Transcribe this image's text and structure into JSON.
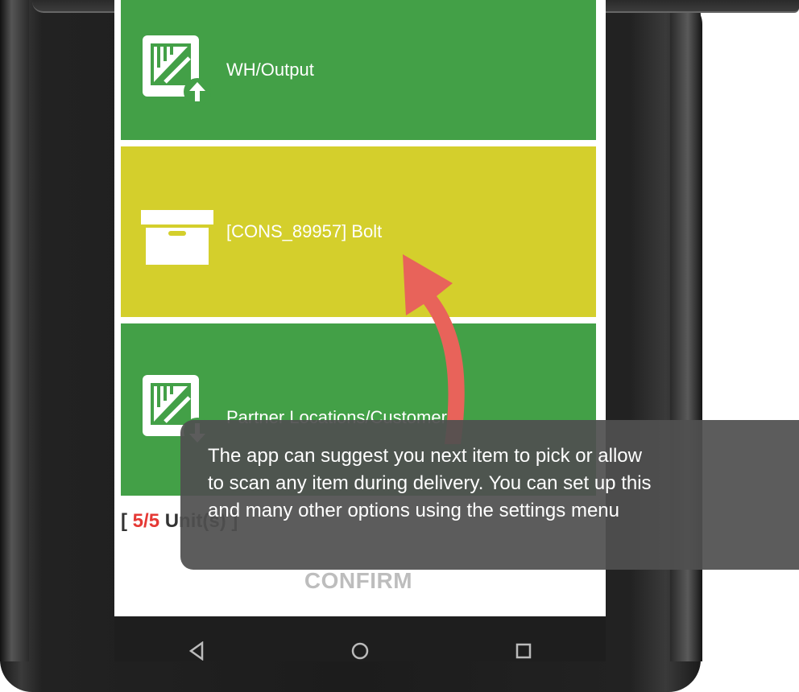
{
  "tiles": [
    {
      "label": "WH/Output",
      "icon": "warehouse-output-icon",
      "color": "#43a047"
    },
    {
      "label": "[CONS_89957] Bolt",
      "icon": "box-icon",
      "color": "#d4cf2c"
    },
    {
      "label": "Partner Locations/Customers",
      "icon": "warehouse-input-icon",
      "color": "#43a047"
    }
  ],
  "status": {
    "prefix": "[ ",
    "count": "5/5",
    "unit": " Unit(s) ]",
    "count_color": "#e53935"
  },
  "confirm_label": "CONFIRM",
  "tooltip": {
    "lines": [
      "The app can suggest you next item to pick or allow",
      "to scan any item during delivery. You can set up this",
      "and many other options using the settings menu"
    ]
  },
  "navbar": {
    "back_icon": "back-triangle-icon",
    "home_icon": "home-circle-icon",
    "recents_icon": "recents-square-icon"
  },
  "annotation": {
    "arrow_color": "#e8635a"
  }
}
